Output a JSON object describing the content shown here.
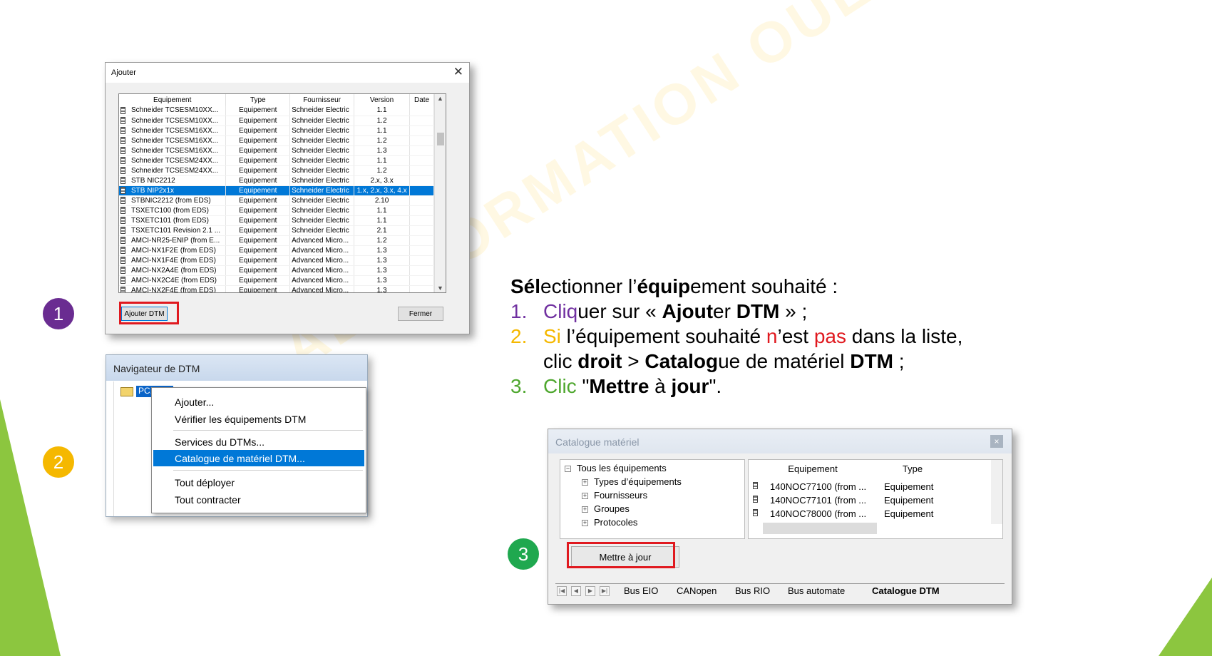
{
  "watermark": "AEC FORMATION OUEST",
  "badges": [
    {
      "label": "1",
      "color": "#6a2c91"
    },
    {
      "label": "2",
      "color": "#f5b800"
    },
    {
      "label": "3",
      "color": "#1fa84f"
    }
  ],
  "ajouter": {
    "title": "Ajouter",
    "close": "✕",
    "columns": [
      "Equipement",
      "Type",
      "Fournisseur",
      "Version",
      "Date"
    ],
    "rows": [
      [
        "Schneider TCSESM10XX...",
        "Equipement",
        "Schneider Electric",
        "1.1",
        ""
      ],
      [
        "Schneider TCSESM10XX...",
        "Equipement",
        "Schneider Electric",
        "1.2",
        ""
      ],
      [
        "Schneider TCSESM16XX...",
        "Equipement",
        "Schneider Electric",
        "1.1",
        ""
      ],
      [
        "Schneider TCSESM16XX...",
        "Equipement",
        "Schneider Electric",
        "1.2",
        ""
      ],
      [
        "Schneider TCSESM16XX...",
        "Equipement",
        "Schneider Electric",
        "1.3",
        ""
      ],
      [
        "Schneider TCSESM24XX...",
        "Equipement",
        "Schneider Electric",
        "1.1",
        ""
      ],
      [
        "Schneider TCSESM24XX...",
        "Equipement",
        "Schneider Electric",
        "1.2",
        ""
      ],
      [
        "STB NIC2212",
        "Equipement",
        "Schneider Electric",
        "2.x, 3.x",
        ""
      ],
      [
        "STB NIP2x1x",
        "Equipement",
        "Schneider Electric",
        "1.x, 2.x, 3.x, 4.x",
        ""
      ],
      [
        "STBNIC2212 (from EDS)",
        "Equipement",
        "Schneider Electric",
        "2.10",
        ""
      ],
      [
        "TSXETC100 (from EDS)",
        "Equipement",
        "Schneider Electric",
        "1.1",
        ""
      ],
      [
        "TSXETC101 (from EDS)",
        "Equipement",
        "Schneider Electric",
        "1.1",
        ""
      ],
      [
        "TSXETC101 Revision 2.1 ...",
        "Equipement",
        "Schneider Electric",
        "2.1",
        ""
      ],
      [
        "AMCI-NR25-ENIP (from E...",
        "Equipement",
        "Advanced Micro...",
        "1.2",
        ""
      ],
      [
        "AMCI-NX1F2E (from EDS)",
        "Equipement",
        "Advanced Micro...",
        "1.3",
        ""
      ],
      [
        "AMCI-NX1F4E (from EDS)",
        "Equipement",
        "Advanced Micro...",
        "1.3",
        ""
      ],
      [
        "AMCI-NX2A4E (from EDS)",
        "Equipement",
        "Advanced Micro...",
        "1.3",
        ""
      ],
      [
        "AMCI-NX2C4E (from EDS)",
        "Equipement",
        "Advanced Micro...",
        "1.3",
        ""
      ],
      [
        "AMCI-NX2F4E (from EDS)",
        "Equipement",
        "Advanced Micro...",
        "1.3",
        ""
      ]
    ],
    "selected_row": 8,
    "add_button": "Ajouter DTM",
    "close_button": "Fermer"
  },
  "navigator": {
    "title": "Navigateur de DTM",
    "node": "PC...",
    "menu": [
      "Ajouter...",
      "Vérifier les équipements DTM",
      "Services du DTMs...",
      "Catalogue de matériel DTM...",
      "Tout déployer",
      "Tout contracter"
    ],
    "selected_item": 3
  },
  "instructions": {
    "heading_b1": "Sél",
    "heading_t1": "ectionner l’",
    "heading_b2": "équip",
    "heading_t2": "ement souhaité :",
    "n1": "1.",
    "s1_c": "Cliq",
    "s1_t1": "uer sur « ",
    "s1_b1": "Ajout",
    "s1_t2": "er ",
    "s1_b2": "DTM",
    "s1_t3": " » ;",
    "n2": "2.",
    "s2_c": "Si",
    "s2_t1": " l’équipement souhaité ",
    "s2_r1": "n",
    "s2_t2": "’est ",
    "s2_r2": "pas",
    "s2_t3": " dans la liste,",
    "s2b_t1": "clic ",
    "s2b_b1": "droit",
    "s2b_t2": " > ",
    "s2b_b2": "Catalog",
    "s2b_t3": "ue de matériel ",
    "s2b_b3": "DTM",
    "s2b_t4": " ;",
    "n3": "3.",
    "s3_c": "Clic",
    "s3_t1": " \"",
    "s3_b1": "Mettre",
    "s3_t2": " à ",
    "s3_b2": "jour",
    "s3_t3": "\".",
    "colors": {
      "purple": "#7030a0",
      "orange": "#f5b800",
      "red": "#e0191f",
      "green": "#4ea72e",
      "number": "#1b2a6b"
    }
  },
  "catalogue": {
    "title": "Catalogue matériel",
    "close": "×",
    "tree": {
      "root": "Tous les équipements",
      "children": [
        "Types d’équipements",
        "Fournisseurs",
        "Groupes",
        "Protocoles"
      ]
    },
    "columns": [
      "Equipement",
      "Type"
    ],
    "rows": [
      [
        "140NOC77100 (from ...",
        "Equipement"
      ],
      [
        "140NOC77101 (from ...",
        "Equipement"
      ],
      [
        "140NOC78000 (from ...",
        "Equipement"
      ]
    ],
    "update_button": "Mettre à jour",
    "tabs": [
      "Bus EIO",
      "CANopen",
      "Bus RIO",
      "Bus automate",
      "Catalogue DTM"
    ],
    "active_tab": 4
  }
}
